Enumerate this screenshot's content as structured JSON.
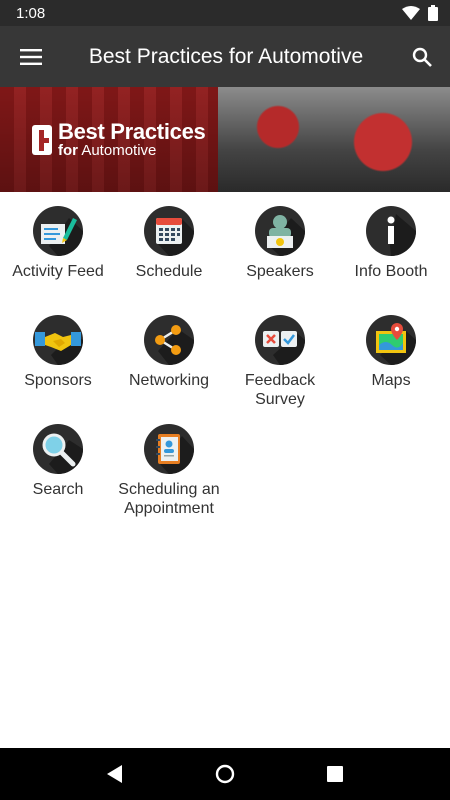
{
  "status_bar": {
    "time": "1:08"
  },
  "app_bar": {
    "title": "Best Practices for Automotive"
  },
  "banner": {
    "logo_line1": "Best Practices",
    "logo_line2_a": "for",
    "logo_line2_b": " Automotive"
  },
  "tiles": [
    {
      "label": "Activity Feed"
    },
    {
      "label": "Schedule"
    },
    {
      "label": "Speakers"
    },
    {
      "label": "Info Booth"
    },
    {
      "label": "Sponsors"
    },
    {
      "label": "Networking"
    },
    {
      "label": "Feedback Survey"
    },
    {
      "label": "Maps"
    },
    {
      "label": "Search"
    },
    {
      "label": "Scheduling an Appointment"
    }
  ],
  "icons": {
    "tile_icons": [
      "activity-feed-icon",
      "schedule-icon",
      "speakers-icon",
      "info-booth-icon",
      "sponsors-icon",
      "networking-icon",
      "feedback-survey-icon",
      "maps-icon",
      "search-icon",
      "appointment-icon"
    ]
  },
  "colors": {
    "app_bar": "#373737",
    "status_bar": "#2b2b2b",
    "icon_bg": "#2d2d2d",
    "accent_red": "#e74c3c"
  }
}
